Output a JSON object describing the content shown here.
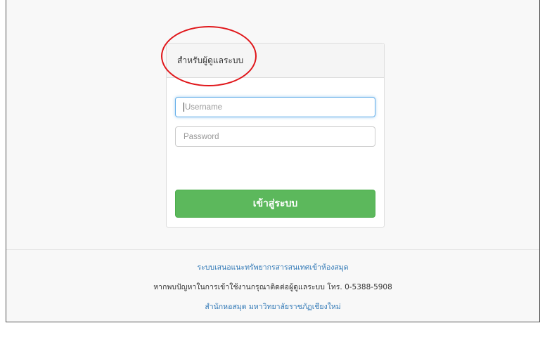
{
  "login_panel": {
    "heading": "สำหรับผู้ดูแลระบบ",
    "username_placeholder": "Username",
    "password_placeholder": "Password",
    "submit_label": "เข้าสู่ระบบ"
  },
  "footer": {
    "system_link": "ระบบเสนอแนะทรัพยากรสารสนเทศเข้าห้องสมุด",
    "contact_text": "หากพบปัญหาในการเข้าใช้งานกรุณาติดต่อผู้ดูแลระบบ โทร. 0-5388-5908",
    "library_link": "สำนักหอสมุด มหาวิทยาลัยราชภัฏเชียงใหม่"
  },
  "colors": {
    "accent_green": "#5cb85c",
    "link_blue": "#337ab7",
    "annotation_red": "#e0161a"
  }
}
